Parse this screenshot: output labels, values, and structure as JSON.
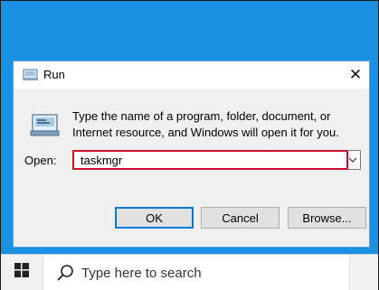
{
  "dialog": {
    "title": "Run",
    "description": "Type the name of a program, folder, document, or Internet resource, and Windows will open it for you.",
    "open_label": "Open:",
    "open_value": "taskmgr",
    "buttons": {
      "ok": "OK",
      "cancel": "Cancel",
      "browse": "Browse..."
    },
    "close_glyph": "✕"
  },
  "taskbar": {
    "search_placeholder": "Type here to search"
  },
  "colors": {
    "desktop": "#1b91e3",
    "highlight": "#c8102e",
    "ok_border": "#0078d7"
  }
}
